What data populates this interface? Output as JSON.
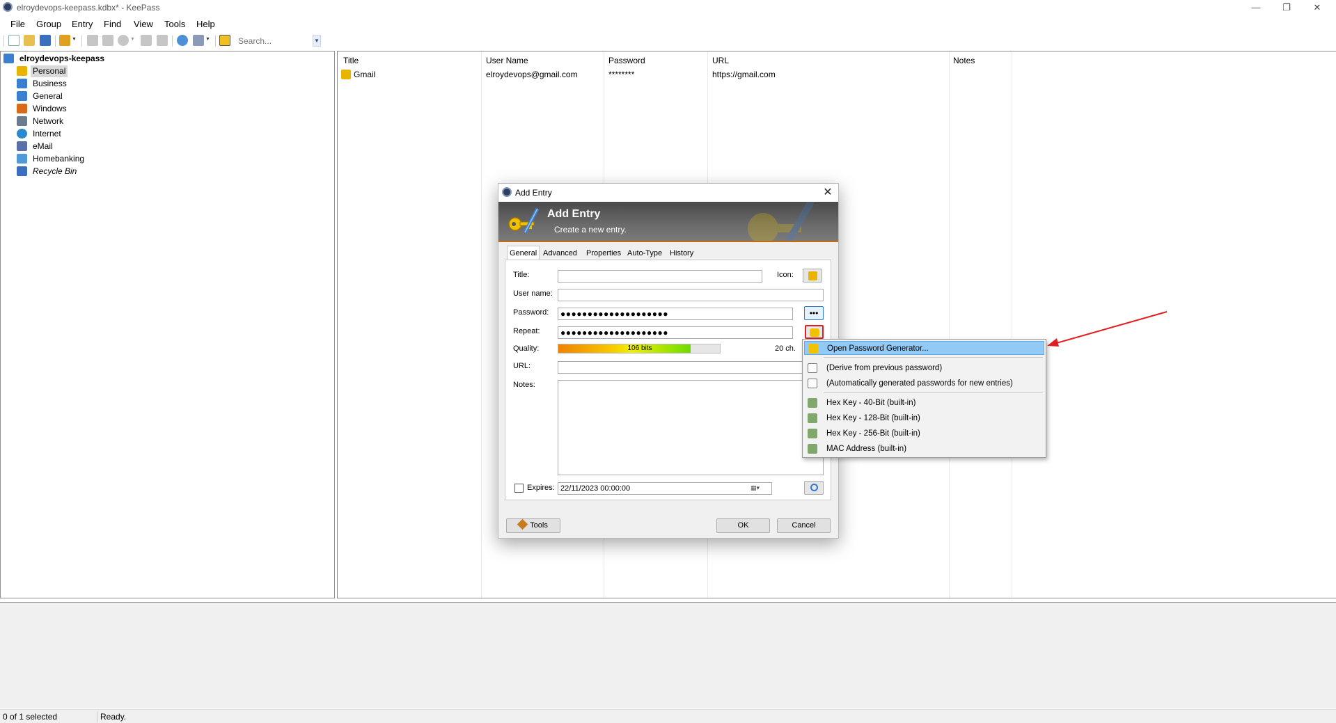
{
  "window": {
    "title": "elroydevops-keepass.kdbx* - KeePass",
    "controls": {
      "minimize": "—",
      "maximize": "❐",
      "close": "✕"
    }
  },
  "menu": [
    "File",
    "Group",
    "Entry",
    "Find",
    "View",
    "Tools",
    "Help"
  ],
  "toolbar": {
    "search_placeholder": "Search...",
    "search_dropdown": "▼"
  },
  "tree": {
    "root": "elroydevops-keepass",
    "groups": [
      {
        "label": "Personal",
        "icon": "personal-icon",
        "color": "#e8b400",
        "selected": true
      },
      {
        "label": "Business",
        "icon": "folder-icon",
        "color": "#3a7fd0"
      },
      {
        "label": "General",
        "icon": "folder-icon",
        "color": "#3a7fd0"
      },
      {
        "label": "Windows",
        "icon": "windows-icon",
        "color": "#d86a1a"
      },
      {
        "label": "Network",
        "icon": "network-icon",
        "color": "#6b7c8f"
      },
      {
        "label": "Internet",
        "icon": "globe-icon",
        "color": "#2a8ad0"
      },
      {
        "label": "eMail",
        "icon": "email-icon",
        "color": "#5b6fa8"
      },
      {
        "label": "Homebanking",
        "icon": "bank-icon",
        "color": "#4f9bd8"
      },
      {
        "label": "Recycle Bin",
        "icon": "recycle-bin-icon",
        "color": "#3a6fc0",
        "italic": true
      }
    ]
  },
  "list": {
    "columns": [
      "Title",
      "User Name",
      "Password",
      "URL",
      "Notes"
    ],
    "rows": [
      {
        "title": "Gmail",
        "username": "elroydevops@gmail.com",
        "password": "********",
        "url": "https://gmail.com",
        "notes": ""
      }
    ]
  },
  "status": {
    "selection": "0 of 1 selected",
    "state": "Ready."
  },
  "dialog": {
    "title": "Add Entry",
    "close": "✕",
    "banner_title": "Add Entry",
    "banner_subtitle": "Create a new entry.",
    "tabs": [
      "General",
      "Advanced",
      "Properties",
      "Auto-Type",
      "History"
    ],
    "labels": {
      "title": "Title:",
      "icon": "Icon:",
      "username": "User name:",
      "password": "Password:",
      "repeat": "Repeat:",
      "quality": "Quality:",
      "url": "URL:",
      "notes": "Notes:",
      "expires": "Expires:"
    },
    "values": {
      "title": "",
      "username": "",
      "password": "●●●●●●●●●●●●●●●●●●●●",
      "repeat": "●●●●●●●●●●●●●●●●●●●●",
      "url": "",
      "notes": "",
      "expires": "22/11/2023 00:00:00",
      "expires_checked": false
    },
    "quality": {
      "bits_label": "106 bits",
      "chars_label": "20 ch.",
      "fill_fraction": 0.82
    },
    "buttons": {
      "show_password": "•••",
      "tools": "Tools",
      "ok": "OK",
      "cancel": "Cancel"
    }
  },
  "password_menu": {
    "items": [
      {
        "label": "Open Password Generator...",
        "icon": "generator-icon",
        "highlighted": true
      },
      {
        "label": "(Derive from previous password)",
        "icon": "derive-icon"
      },
      {
        "label": "(Automatically generated passwords for new entries)",
        "icon": "auto-generate-icon"
      },
      {
        "label": "Hex Key - 40-Bit (built-in)",
        "icon": "profile-icon"
      },
      {
        "label": "Hex Key - 128-Bit (built-in)",
        "icon": "profile-icon"
      },
      {
        "label": "Hex Key - 256-Bit (built-in)",
        "icon": "profile-icon"
      },
      {
        "label": "MAC Address (built-in)",
        "icon": "profile-icon"
      }
    ]
  },
  "colors": {
    "highlight_box": "#e02020",
    "menu_hover": "#91c9f7",
    "annotation_arrow": "#e02020"
  }
}
